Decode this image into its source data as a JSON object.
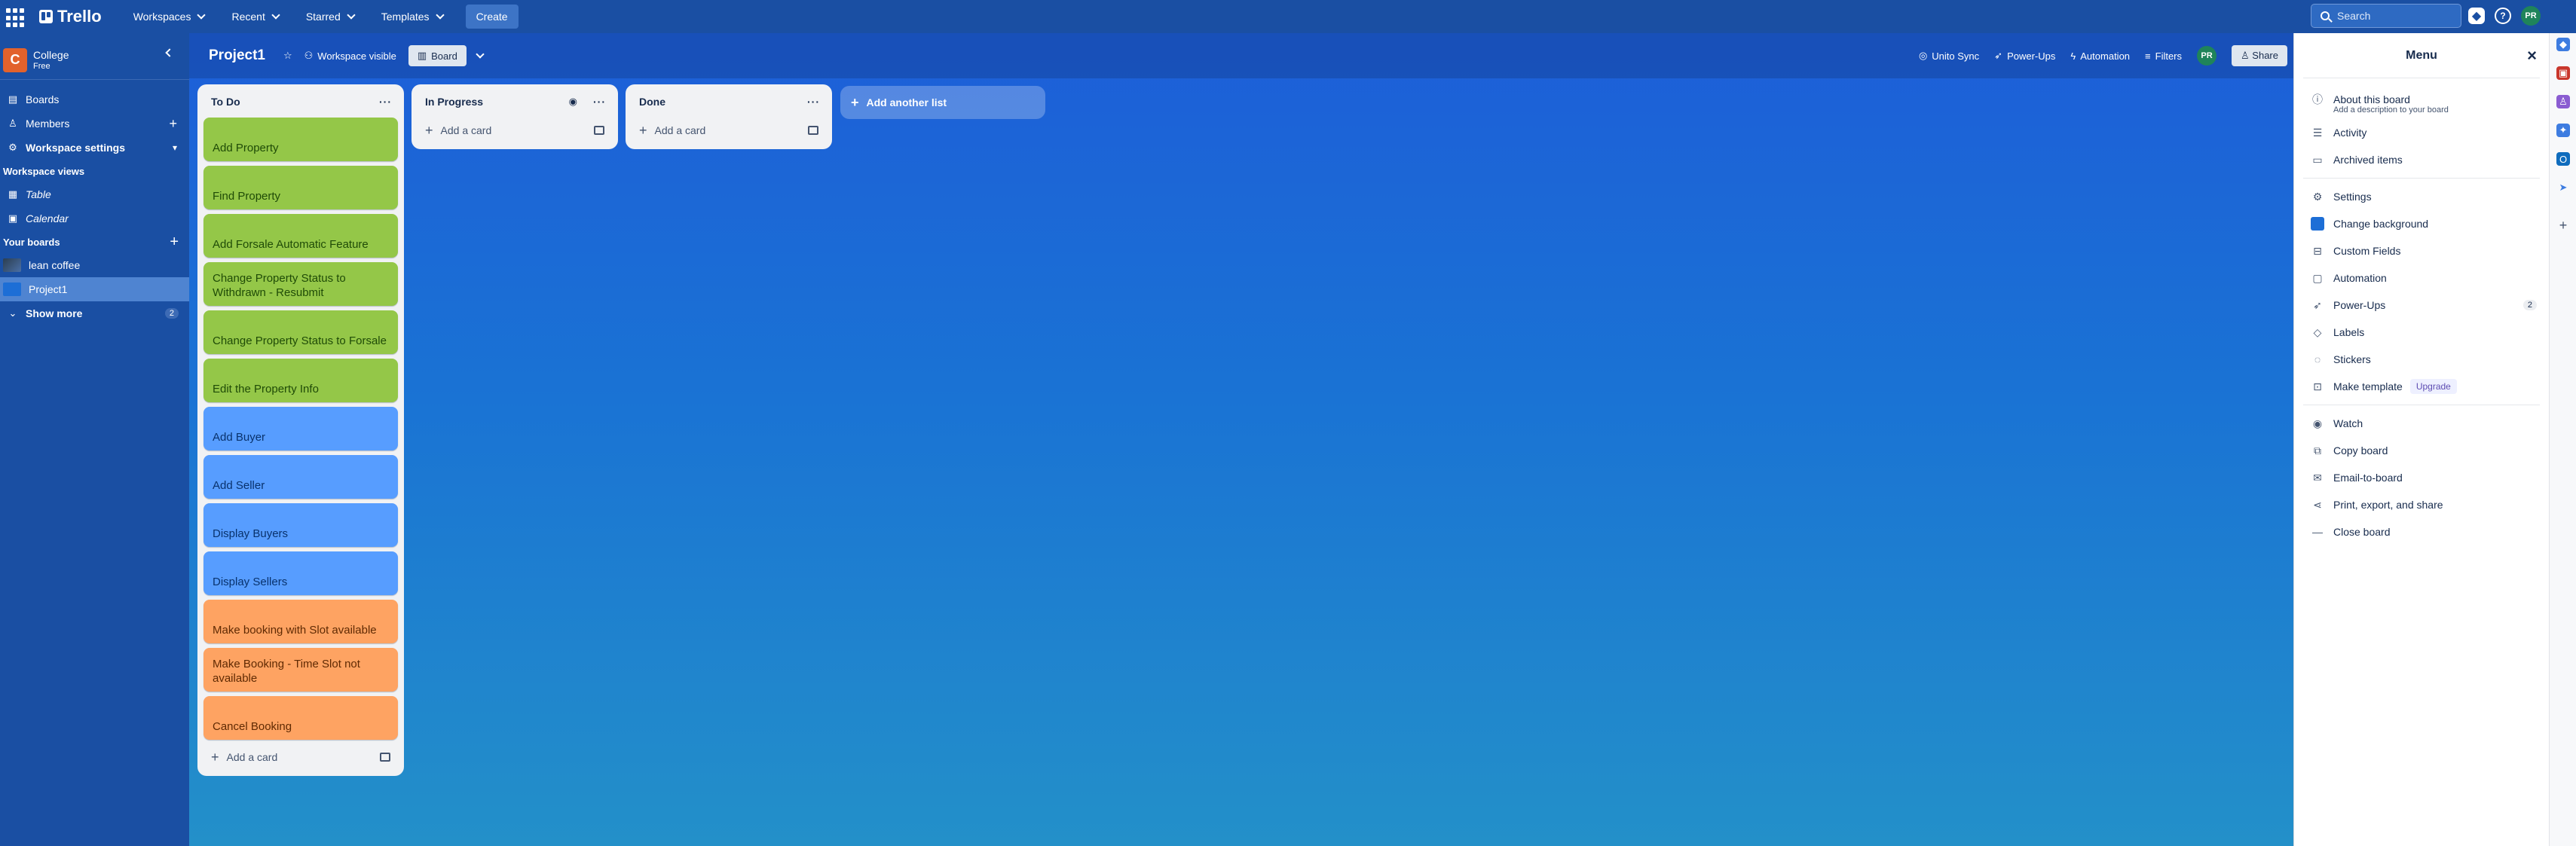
{
  "topbar": {
    "logo": "Trello",
    "nav": [
      "Workspaces",
      "Recent",
      "Starred",
      "Templates"
    ],
    "create": "Create",
    "search_placeholder": "Search",
    "help": "?",
    "user_initials": "PR"
  },
  "sidebar": {
    "workspace_initial": "C",
    "workspace_name": "College",
    "workspace_plan": "Free",
    "items": [
      {
        "label": "Boards"
      },
      {
        "label": "Members"
      },
      {
        "label": "Workspace settings"
      }
    ],
    "views_title": "Workspace views",
    "views": [
      {
        "label": "Table"
      },
      {
        "label": "Calendar"
      }
    ],
    "boards_title": "Your boards",
    "boards": [
      {
        "label": "lean coffee"
      },
      {
        "label": "Project1"
      }
    ],
    "show_more": "Show more",
    "show_more_count": "2"
  },
  "board": {
    "title": "Project1",
    "visibility": "Workspace visible",
    "view": "Board",
    "unito": "Unito Sync",
    "powerups": "Power-Ups",
    "automation": "Automation",
    "filters": "Filters",
    "share": "Share",
    "member_initials": "PR",
    "add_list": "Add another list",
    "add_card": "Add a card",
    "lists": [
      {
        "title": "To Do",
        "cards": [
          {
            "title": "Add Property",
            "color": "green"
          },
          {
            "title": "Find Property",
            "color": "green"
          },
          {
            "title": "Add Forsale Automatic Feature",
            "color": "green"
          },
          {
            "title": "Change Property Status to Withdrawn - Resubmit",
            "color": "green"
          },
          {
            "title": "Change Property Status to Forsale",
            "color": "green"
          },
          {
            "title": "Edit the Property Info",
            "color": "green"
          },
          {
            "title": "Add Buyer",
            "color": "blue"
          },
          {
            "title": "Add Seller",
            "color": "blue"
          },
          {
            "title": "Display Buyers",
            "color": "blue"
          },
          {
            "title": "Display Sellers",
            "color": "blue"
          },
          {
            "title": "Make booking with Slot available",
            "color": "orange"
          },
          {
            "title": "Make Booking - Time Slot not available",
            "color": "orange"
          },
          {
            "title": "Cancel Booking",
            "color": "orange"
          }
        ]
      },
      {
        "title": "In Progress",
        "cards": []
      },
      {
        "title": "Done",
        "cards": []
      }
    ]
  },
  "menu": {
    "title": "Menu",
    "about": "About this board",
    "about_sub": "Add a description to your board",
    "group1": [
      "Activity",
      "Archived items"
    ],
    "group2": [
      "Settings",
      "Change background",
      "Custom Fields",
      "Automation",
      "Power-Ups",
      "Labels",
      "Stickers",
      "Make template"
    ],
    "powerups_count": "2",
    "upgrade": "Upgrade",
    "group3": [
      "Watch",
      "Copy board",
      "Email-to-board",
      "Print, export, and share",
      "Close board"
    ]
  },
  "colors": {
    "green": "#94c748",
    "blue": "#579dff",
    "orange": "#fea362",
    "topbar": "#1a4fa3",
    "workspace_logo": "#e2622c"
  }
}
